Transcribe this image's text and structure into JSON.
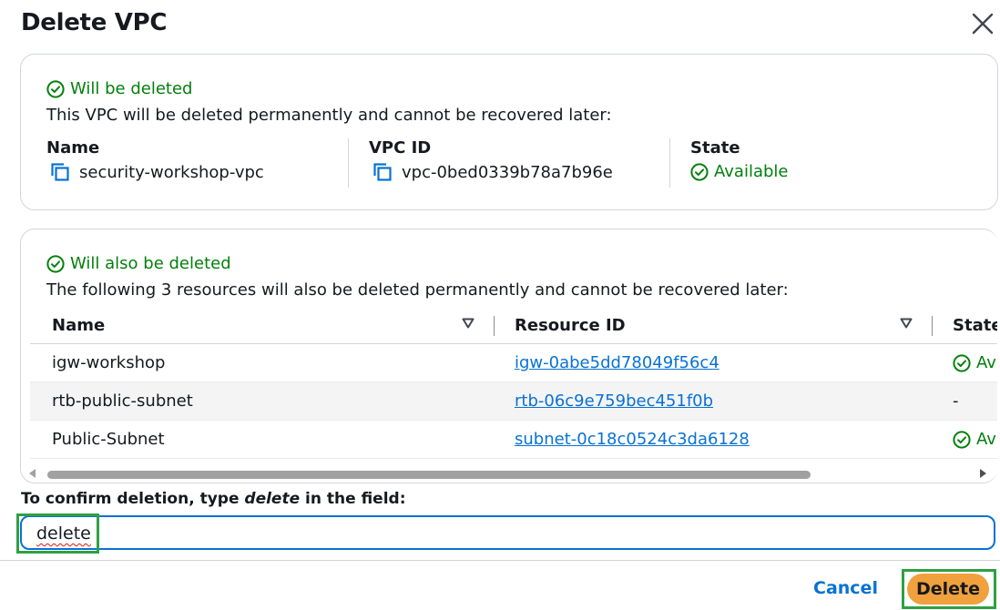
{
  "modal": {
    "title": "Delete VPC",
    "close_icon": "close-icon"
  },
  "vpc_card": {
    "status": "Will be deleted",
    "description": "This VPC will be deleted permanently and cannot be recovered later:",
    "fields": {
      "name_label": "Name",
      "name_value": "security-workshop-vpc",
      "id_label": "VPC ID",
      "id_value": "vpc-0bed0339b78a7b96e",
      "state_label": "State",
      "state_value": "Available"
    }
  },
  "resources_card": {
    "status": "Will also be deleted",
    "description": "The following 3 resources will also be deleted permanently and cannot be recovered later:",
    "columns": [
      "Name",
      "Resource ID",
      "State"
    ],
    "rows": [
      {
        "name": "igw-workshop",
        "resource_id": "igw-0abe5dd78049f56c4",
        "state": "Ava"
      },
      {
        "name": "rtb-public-subnet",
        "resource_id": "rtb-06c9e759bec451f0b",
        "state": "-"
      },
      {
        "name": "Public-Subnet",
        "resource_id": "subnet-0c18c0524c3da6128",
        "state": "Ava"
      }
    ]
  },
  "confirm": {
    "label_prefix": "To confirm deletion, type ",
    "label_keyword": "delete",
    "label_suffix": " in the field:",
    "input_value": "delete"
  },
  "footer": {
    "cancel_label": "Cancel",
    "delete_label": "Delete"
  },
  "colors": {
    "success": "#037f0c",
    "link": "#0972d3",
    "primary_button": "#f0a03c",
    "highlight": "#2ea043"
  }
}
